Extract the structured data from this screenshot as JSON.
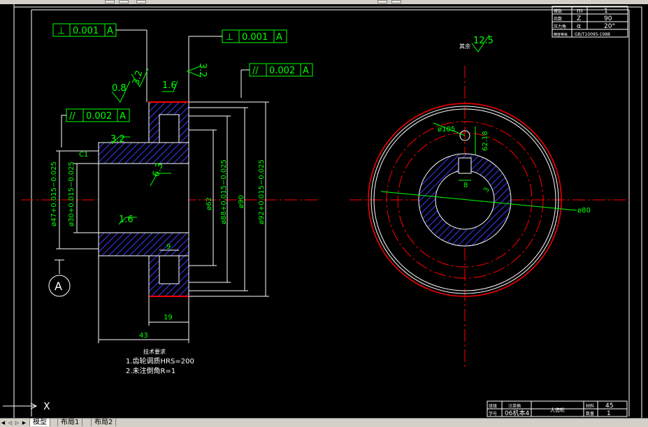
{
  "drawing": {
    "tolerance_frames": [
      {
        "symbol": "⊥",
        "value": "0.001",
        "datum": "A"
      },
      {
        "symbol": "⊥",
        "value": "0.001",
        "datum": "A"
      },
      {
        "symbol": "//",
        "value": "0.002",
        "datum": "A"
      },
      {
        "symbol": "//",
        "value": "0.002",
        "datum": "A"
      }
    ],
    "roughness": {
      "r1": "3.2",
      "r2": "0.8",
      "r3": "1.6",
      "r4": "3.2",
      "r5": "3.2",
      "r6": "6.3",
      "r7": "1.6",
      "r8": "3.2",
      "rest_label": "其余",
      "rest_value": "12.5"
    },
    "chamfer": "C1",
    "dimensions": {
      "d47": "ø47+0.015−0.025",
      "d30": "ø30+0.015−0.025",
      "d62": "ø62",
      "d88": "ø88+0.015−0.025",
      "d90": "ø90",
      "d92": "ø92+0.015−0.025",
      "w9": "9",
      "w19": "19",
      "w43": "43",
      "hole": "ø105",
      "keyway": "62.18",
      "key_width": "8",
      "chord": "3",
      "pcd": "ø80"
    },
    "datum_label": "A",
    "tech_notes": {
      "title": "技术要求",
      "line1": "1.齿轮调质HRS=200",
      "line2": "2.未注倒角R=1"
    },
    "gear_params": [
      [
        "模数",
        "m",
        "1"
      ],
      [
        "齿数",
        "Z",
        "90"
      ],
      [
        "压力角",
        "α",
        "20°"
      ],
      [
        "精度等级",
        "GB/T10095-1988",
        ""
      ]
    ],
    "title_block": {
      "designer_label": "班级",
      "designer_value": "汪英楠",
      "class_label": "学号",
      "class_value": "06机本4",
      "part_name": "大齿轮",
      "material_label": "材料",
      "material_value": "45",
      "qty_label": "数量",
      "qty_value": "1"
    },
    "ucs_x": "X"
  },
  "tabs": [
    "模型",
    "布局1",
    "布局2"
  ],
  "colors": {
    "background": "#000000",
    "green": "#00ff00",
    "red": "#ff0000",
    "blue_hatch": "#3a3aff",
    "white": "#ffffff",
    "cyan": "#00ffff"
  }
}
